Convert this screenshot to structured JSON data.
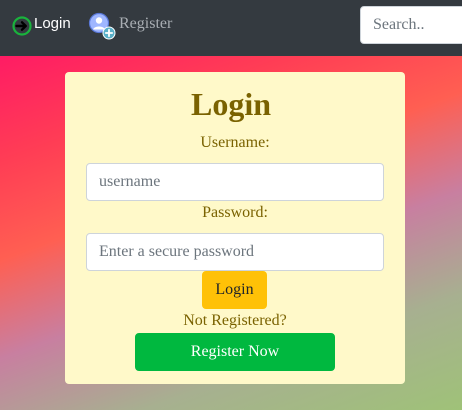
{
  "navbar": {
    "login_label": "Login",
    "login_icon": "login-arrow-icon",
    "register_label": "Register",
    "register_icon": "add-user-icon",
    "search_placeholder": "Search.."
  },
  "form": {
    "title": "Login",
    "username_label": "Username:",
    "username_placeholder": "username",
    "password_label": "Password:",
    "password_placeholder": "Enter a secure password",
    "login_button": "Login",
    "not_registered": "Not Registered?",
    "register_button": "Register Now"
  },
  "colors": {
    "navbar_bg": "#343a40",
    "card_bg": "#fff9c9",
    "text_gold": "#7a6200",
    "login_button_bg": "#ffc107",
    "register_button_bg": "#00b83f",
    "login_icon_green": "#19b33c"
  }
}
